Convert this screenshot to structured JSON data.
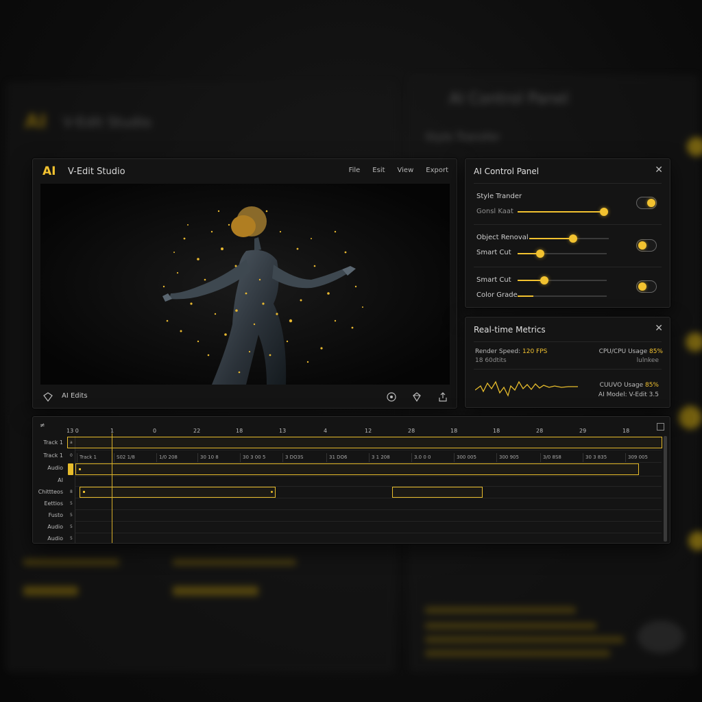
{
  "editor": {
    "logo": "AI",
    "title": "V-Edit Studio",
    "menu": [
      "File",
      "Esit",
      "View",
      "Export"
    ],
    "footer_label": "AI Edits",
    "icons": [
      "cube-icon",
      "target-icon",
      "diamond-icon",
      "export-icon"
    ]
  },
  "ai_panel": {
    "title": "AI Control Panel",
    "close": "✕",
    "groups": [
      {
        "labels": [
          "Style Trander",
          "Gonsl Kaat"
        ],
        "sliders": [
          0.97
        ],
        "toggle_on": true
      },
      {
        "labels": [
          "Object Renoval",
          "Smart Cut"
        ],
        "sliders": [
          0.55,
          0.25
        ],
        "toggle_on": true
      },
      {
        "labels": [
          "Smart Cut",
          "Color Grade"
        ],
        "sliders": [
          0.3,
          0.18
        ],
        "toggle_on": true
      }
    ]
  },
  "metrics": {
    "title": "Real-time Metrics",
    "close": "✕",
    "render_label": "Render Speed: ",
    "render_value": "120 FPS",
    "render_sub": "18 60dtits",
    "cpu_label": "CPU/CPU Usage ",
    "cpu_value": "85%",
    "cpu_sub": "lulnkee",
    "gpu_label": "CUUVO Usage ",
    "gpu_value": "85%",
    "model_label": "AI Model: V-Edit 3.5",
    "accent": "#f2c230"
  },
  "timeline": {
    "corner": "≠",
    "ticks": [
      "13 0",
      "1",
      "0",
      "22",
      "18",
      "13",
      "4",
      "12",
      "28",
      "18",
      "18",
      "28",
      "29",
      "18"
    ],
    "row_labels": [
      "Track 1",
      "Track 1",
      "Audio",
      "AI",
      "Chittteos",
      "Eettios",
      "Fusto",
      "Audio",
      "Audio"
    ],
    "row_markers": [
      "a",
      "0",
      "",
      "",
      "8",
      "5",
      "5",
      "5",
      "5"
    ],
    "ruler": [
      "Track 1",
      "S02 1/8",
      "1/0 208",
      "30 10 8",
      "30 3 00 5",
      "3 DO3S",
      "31 DO6",
      "3 1 208",
      "3.0 0 0",
      "300 005",
      "300 905",
      "3/0 8S8",
      "30 3 835",
      "309 005"
    ]
  },
  "background": {
    "logo": "AI",
    "title": "V-Edit Studio",
    "panel_title": "AI Control Panel",
    "style_label": "Style Transfer"
  }
}
